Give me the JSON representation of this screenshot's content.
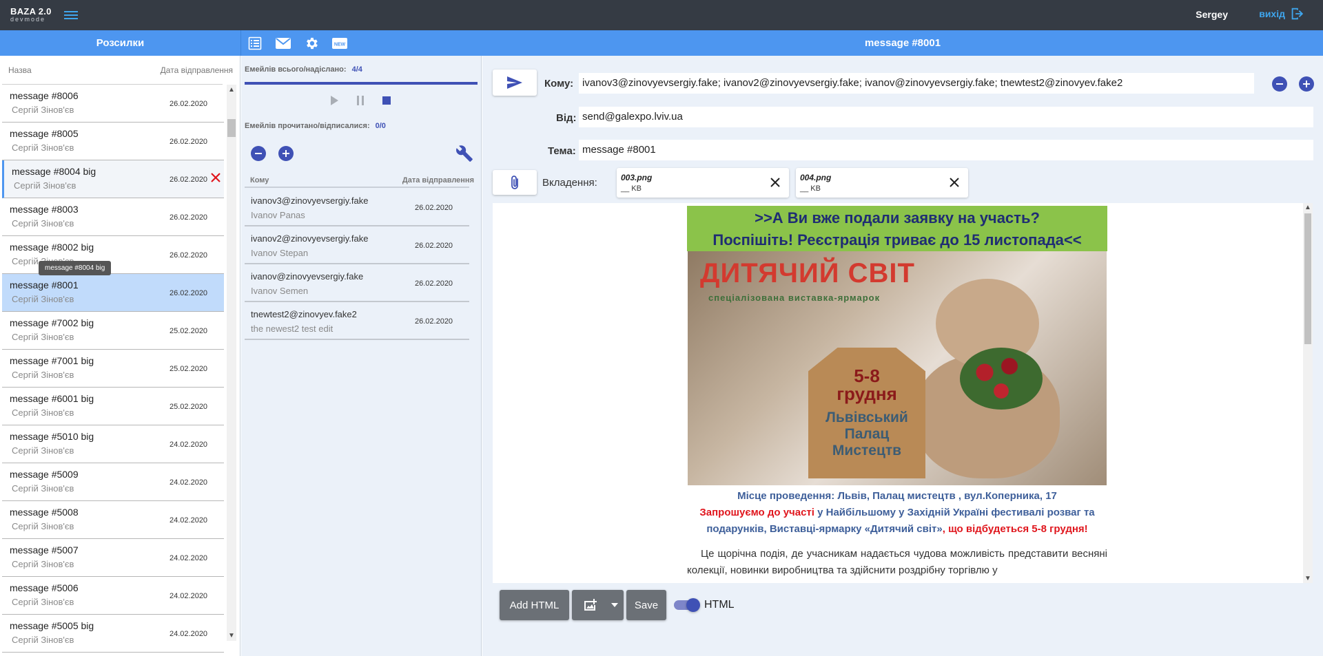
{
  "app": {
    "name": "BAZA 2.0",
    "mode": "devmode"
  },
  "user": {
    "name": "Sergey",
    "logout_label": "вихід"
  },
  "left": {
    "title": "Розсилки",
    "col_name": "Назва",
    "col_date": "Дата відправлення",
    "tooltip": "message #8004 big",
    "items": [
      {
        "title": "message #8006",
        "author": "Сергій Зінов'єв",
        "date": "26.02.2020"
      },
      {
        "title": "message #8005",
        "author": "Сергій Зінов'єв",
        "date": "26.02.2020"
      },
      {
        "title": "message #8004 big",
        "author": "Сергій Зінов'єв",
        "date": "26.02.2020"
      },
      {
        "title": "message #8003",
        "author": "Сергій Зінов'єв",
        "date": "26.02.2020"
      },
      {
        "title": "message #8002 big",
        "author": "Сергій Зінов'єв",
        "date": "26.02.2020"
      },
      {
        "title": "message #8001",
        "author": "Сергій Зінов'єв",
        "date": "26.02.2020"
      },
      {
        "title": "message #7002 big",
        "author": "Сергій Зінов'єв",
        "date": "25.02.2020"
      },
      {
        "title": "message #7001 big",
        "author": "Сергій Зінов'єв",
        "date": "25.02.2020"
      },
      {
        "title": "message #6001 big",
        "author": "Сергій Зінов'єв",
        "date": "25.02.2020"
      },
      {
        "title": "message #5010 big",
        "author": "Сергій Зінов'єв",
        "date": "24.02.2020"
      },
      {
        "title": "message #5009",
        "author": "Сергій Зінов'єв",
        "date": "24.02.2020"
      },
      {
        "title": "message #5008",
        "author": "Сергій Зінов'єв",
        "date": "24.02.2020"
      },
      {
        "title": "message #5007",
        "author": "Сергій Зінов'єв",
        "date": "24.02.2020"
      },
      {
        "title": "message #5006",
        "author": "Сергій Зінов'єв",
        "date": "24.02.2020"
      },
      {
        "title": "message #5005 big",
        "author": "Сергій Зінов'єв",
        "date": "24.02.2020"
      }
    ]
  },
  "middle": {
    "sent_label": "Емейлів всього/надіслано:",
    "sent_value": "4/4",
    "read_label": "Емейлів прочитано/відписалися:",
    "read_value": "0/0",
    "progress": 1.0,
    "col_to": "Кому",
    "col_date": "Дата відправлення",
    "recipients": [
      {
        "email": "ivanov3@zinovyevsergiy.fake",
        "name": "Ivanov Panas",
        "date": "26.02.2020"
      },
      {
        "email": "ivanov2@zinovyevsergiy.fake",
        "name": "Ivanov Stepan",
        "date": "26.02.2020"
      },
      {
        "email": "ivanov@zinovyevsergiy.fake",
        "name": "Ivanov Semen",
        "date": "26.02.2020"
      },
      {
        "email": "tnewtest2@zinovyev.fake2",
        "name": "the newest2 test edit",
        "date": "26.02.2020"
      }
    ]
  },
  "message": {
    "header_title": "message #8001",
    "to_label": "Кому:",
    "to_value": "ivanov3@zinovyevsergiy.fake; ivanov2@zinovyevsergiy.fake; ivanov@zinovyevsergiy.fake; tnewtest2@zinovyev.fake2",
    "from_label": "Від:",
    "from_value": "send@galexpo.lviv.ua",
    "subject_label": "Тема:",
    "subject_value": "message #8001",
    "attach_label": "Вкладення:",
    "attachments": [
      {
        "name": "003.png",
        "size": "__ KB"
      },
      {
        "name": "004.png",
        "size": "__ KB"
      }
    ]
  },
  "email_body": {
    "banner_line1": ">>А Ви вже подали заявку на участь?",
    "banner_line2": "Поспішіть! Реєстрація триває до 15 листопада<<",
    "logo_text": "ДИТЯЧИЙ СВІТ",
    "logo_sub": "спеціалізована виставка-ярмарок",
    "box_line1": "5-8",
    "box_line2": "грудня",
    "box_line3": "Львівський",
    "box_line4": "Палац",
    "box_line5": "Мистецтв",
    "venue": "Місце проведення: Львів, Палац мистецтв , вул.Коперника, 17",
    "invite_red": "Запрошуємо до участі",
    "invite_blue": " у Найбільшому у Західній Україні фестивалі розваг та подарунків, Виставці-ярмарку «Дитячий світ»",
    "invite_red2": ", що відбудеться 5-8 грудня!",
    "paragraph": "Це щорічна подія, де учасникам надається чудова можливість представити весняні колекції, новинки виробництва та здійснити роздрібну торгівлю у"
  },
  "toolbar": {
    "add_html": "Add HTML",
    "save": "Save",
    "html_toggle": "HTML"
  },
  "colors": {
    "topbar": "#353b44",
    "accent": "#4d96f0",
    "primary": "#3f51b5",
    "selected_row": "#c1dbfb",
    "danger": "#e0161d"
  }
}
